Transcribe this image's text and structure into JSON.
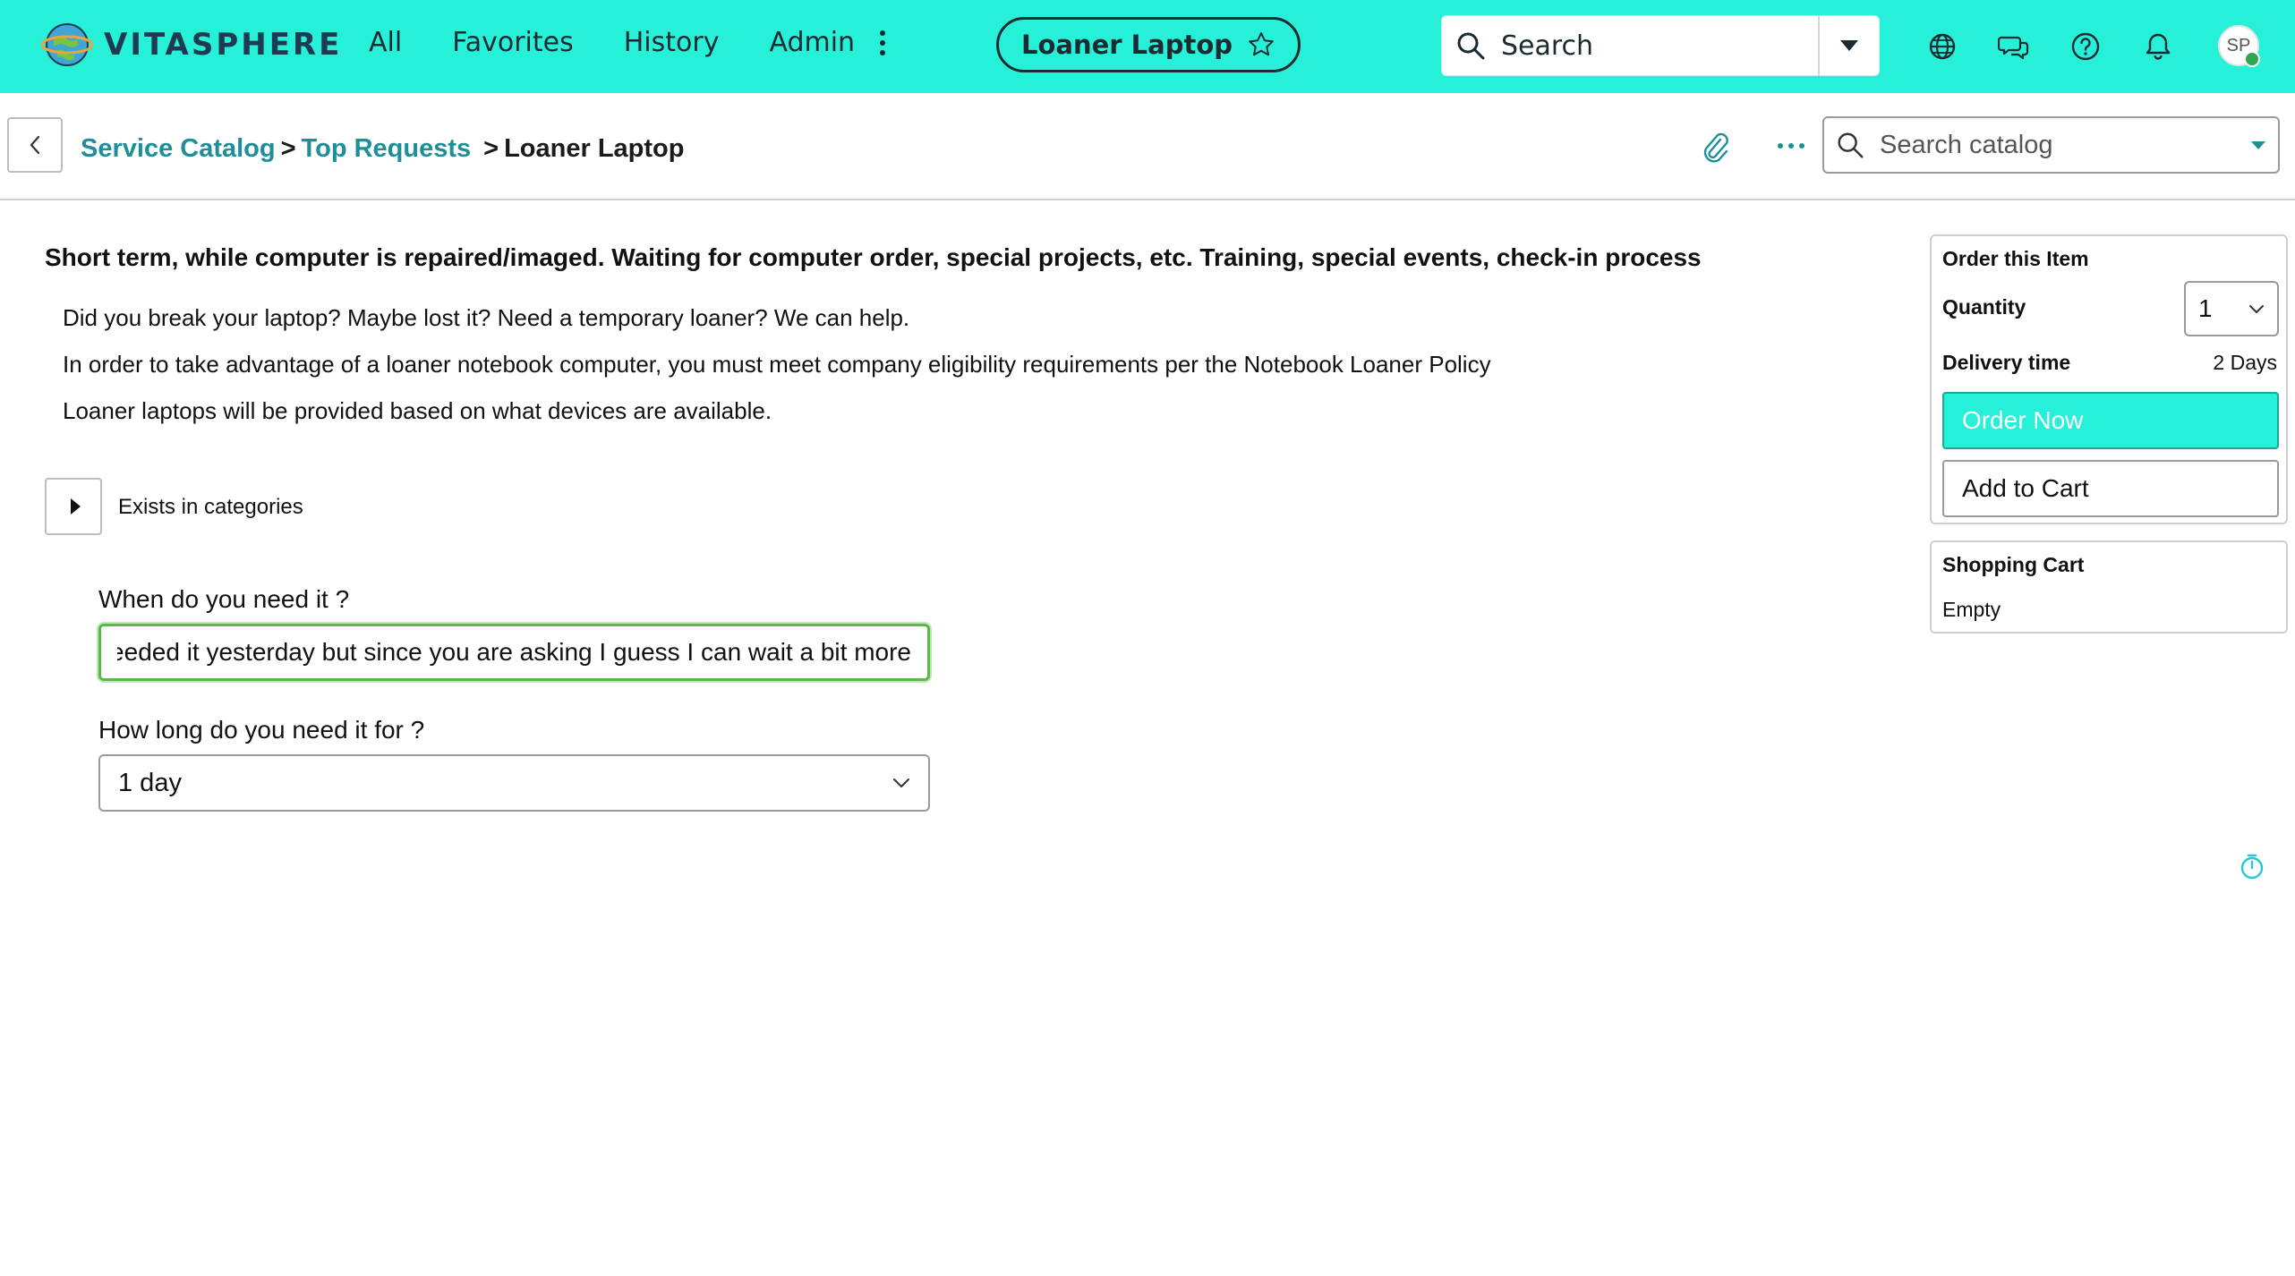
{
  "brand": {
    "name": "VITASPHERE",
    "logo_icon": "globe-logo-icon",
    "accent": "#27f0d8",
    "link_color": "#1e8f99",
    "focus_color": "#5ab84b"
  },
  "topnav": {
    "links": [
      "All",
      "Favorites",
      "History",
      "Admin"
    ],
    "more_icon": "vertical-dots-icon",
    "current_item": "Loaner Laptop",
    "favorite_icon": "star-outline-icon",
    "search_placeholder": "Search",
    "icons": [
      "globe-icon",
      "chat-icon",
      "help-icon",
      "bell-icon"
    ],
    "avatar_initials": "SP"
  },
  "breadcrumb": {
    "items": [
      "Service Catalog",
      "Top Requests"
    ],
    "separator": ">",
    "current": "Loaner Laptop"
  },
  "catalog_search": {
    "placeholder": "Search catalog"
  },
  "item": {
    "headline": "Short term, while computer is repaired/imaged. Waiting for computer order, special projects, etc. Training, special events, check-in process",
    "description": [
      "Did you break your laptop?  Maybe lost it?  Need a temporary loaner?  We can help.",
      "In order to take advantage of a loaner notebook computer, you must meet company eligibility requirements per the Notebook Loaner Policy",
      "Loaner laptops will be provided based on what devices are available."
    ],
    "categories_label": "Exists in categories"
  },
  "form": {
    "when_label": "When do you need it ?",
    "when_value": "I needed it yesterday but since you are asking I guess I can wait a bit more",
    "how_long_label": "How long do you need it for ?",
    "how_long_value": "1 day"
  },
  "order": {
    "title": "Order this Item",
    "quantity_label": "Quantity",
    "quantity_value": "1",
    "delivery_label": "Delivery time",
    "delivery_value": "2 Days",
    "order_now": "Order Now",
    "add_to_cart": "Add to Cart"
  },
  "cart": {
    "title": "Shopping Cart",
    "status": "Empty"
  }
}
